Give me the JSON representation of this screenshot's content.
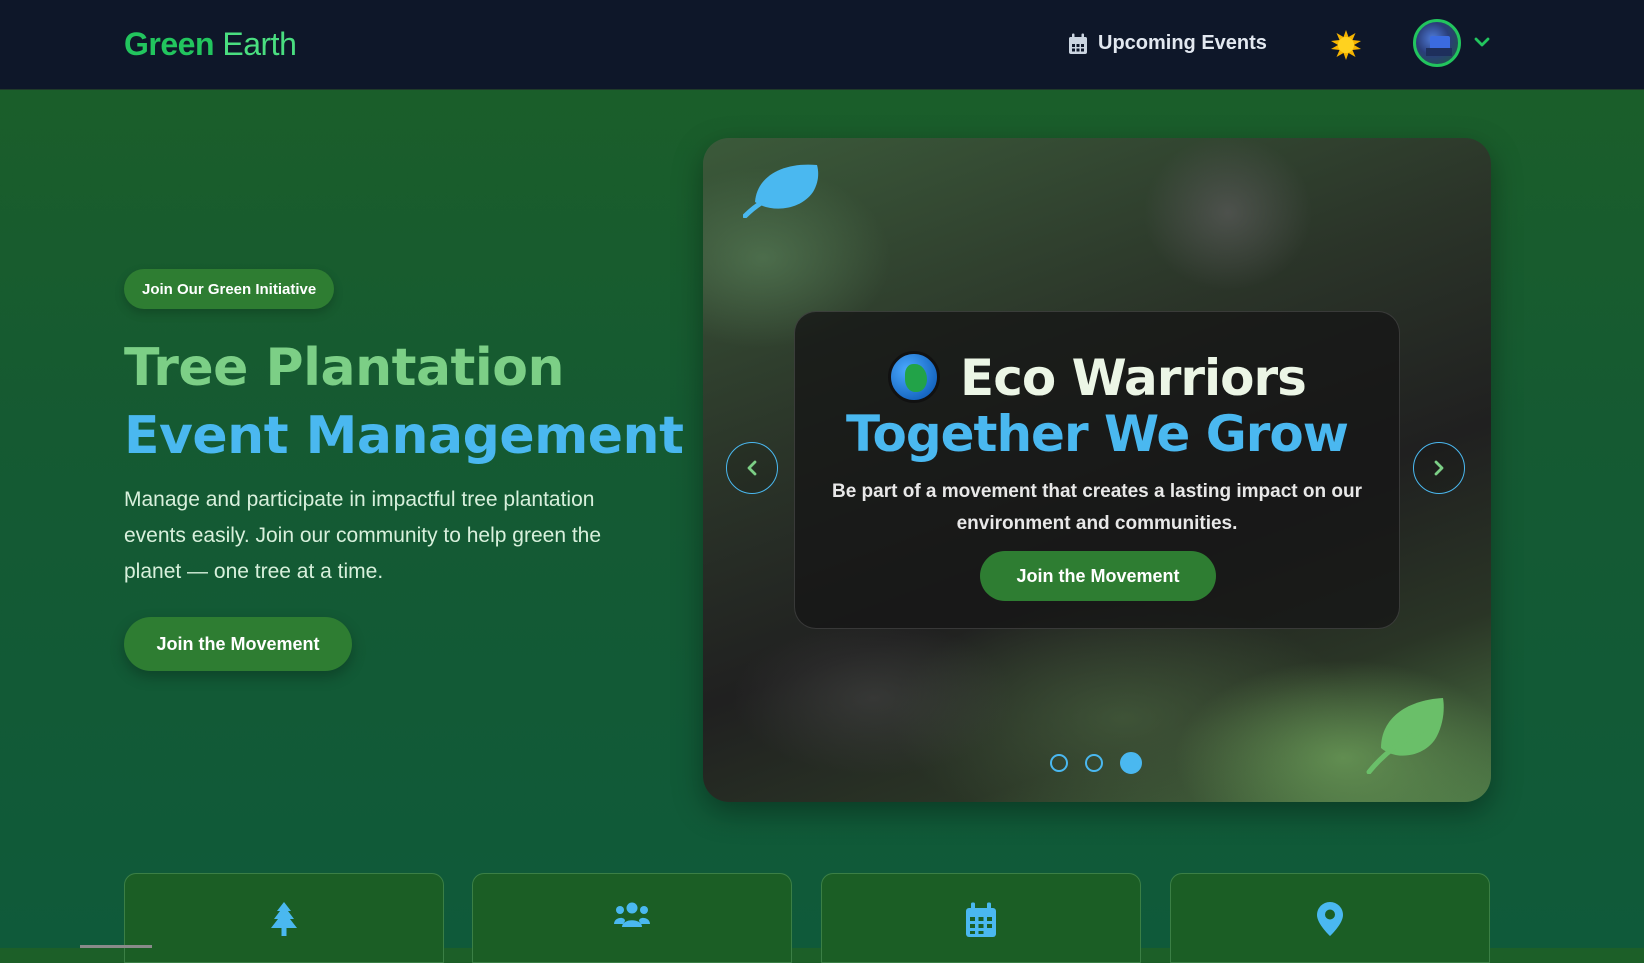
{
  "nav": {
    "logo_bold": "Green",
    "logo_light": "Earth",
    "events_link": "Upcoming Events"
  },
  "hero": {
    "badge": "Join Our Green Initiative",
    "title_line1": "Tree Plantation",
    "title_line2": "Event Management",
    "description": "Manage and participate in impactful tree plantation events easily. Join our community to help green the planet — one tree at a time.",
    "cta": "Join the Movement"
  },
  "slide": {
    "title_line1": "Eco Warriors",
    "title_line2": "Together We Grow",
    "text": "Be part of a movement that creates a lasting impact on our environment and communities.",
    "cta": "Join the Movement",
    "total_slides": 3,
    "active_slide": 3
  },
  "features": [
    {
      "icon": "tree-icon"
    },
    {
      "icon": "users-icon"
    },
    {
      "icon": "calendar-icon"
    },
    {
      "icon": "map-pin-icon"
    }
  ],
  "colors": {
    "nav_bg": "#0e1729",
    "accent_green": "#2e7d32",
    "accent_blue": "#4ab8f0",
    "logo_green": "#22c55e"
  }
}
